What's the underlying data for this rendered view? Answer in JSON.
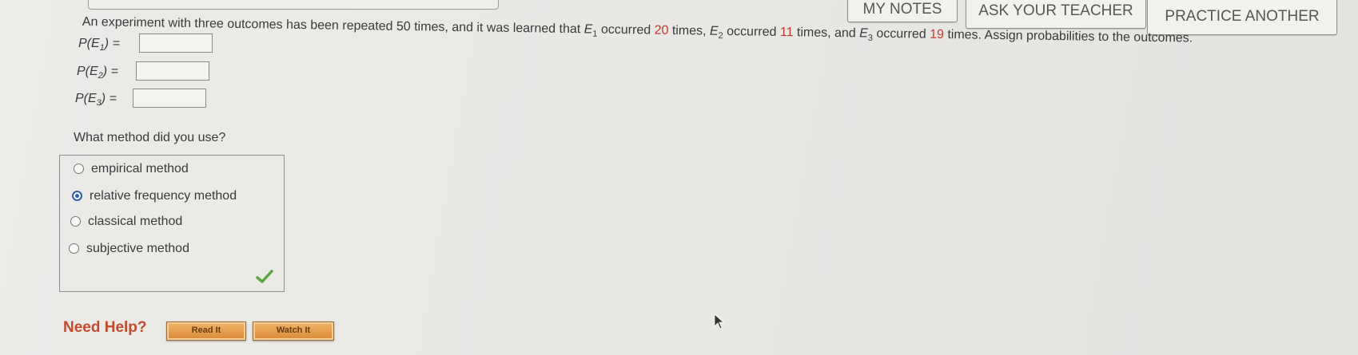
{
  "toolbar": {
    "my_notes": "MY NOTES",
    "ask_teacher": "ASK YOUR TEACHER",
    "practice_another": "PRACTICE ANOTHER"
  },
  "question": {
    "part1": "An experiment with three outcomes has been repeated 50 times, and it was learned that ",
    "e1": "E",
    "e1_sub": "1",
    "part2": " occurred ",
    "count1": "20",
    "part3": " times, ",
    "e2": "E",
    "e2_sub": "2",
    "part4": " occurred ",
    "count2": "11",
    "part5": " times, and ",
    "e3": "E",
    "e3_sub": "3",
    "part6": " occurred ",
    "count3": "19",
    "part7": " times. Assign probabilities to the outcomes."
  },
  "probabilities": [
    {
      "label_pre": "P(E",
      "sub": "1",
      "label_post": ") =",
      "value": ""
    },
    {
      "label_pre": "P(E",
      "sub": "2",
      "label_post": ") =",
      "value": ""
    },
    {
      "label_pre": "P(E",
      "sub": "3",
      "label_post": ") =",
      "value": ""
    }
  ],
  "method": {
    "question": "What method did you use?",
    "options": [
      {
        "label": "empirical method",
        "selected": false
      },
      {
        "label": "relative frequency method",
        "selected": true
      },
      {
        "label": "classical method",
        "selected": false
      },
      {
        "label": "subjective method",
        "selected": false
      }
    ],
    "status_icon": "check-icon",
    "status_color": "#5aa640"
  },
  "help": {
    "label": "Need Help?",
    "read_it": "Read It",
    "watch_it": "Watch It"
  },
  "colors": {
    "accent_red": "#c33a2e",
    "radio_selected": "#2f5ea8",
    "help_button": "#e39a45"
  }
}
